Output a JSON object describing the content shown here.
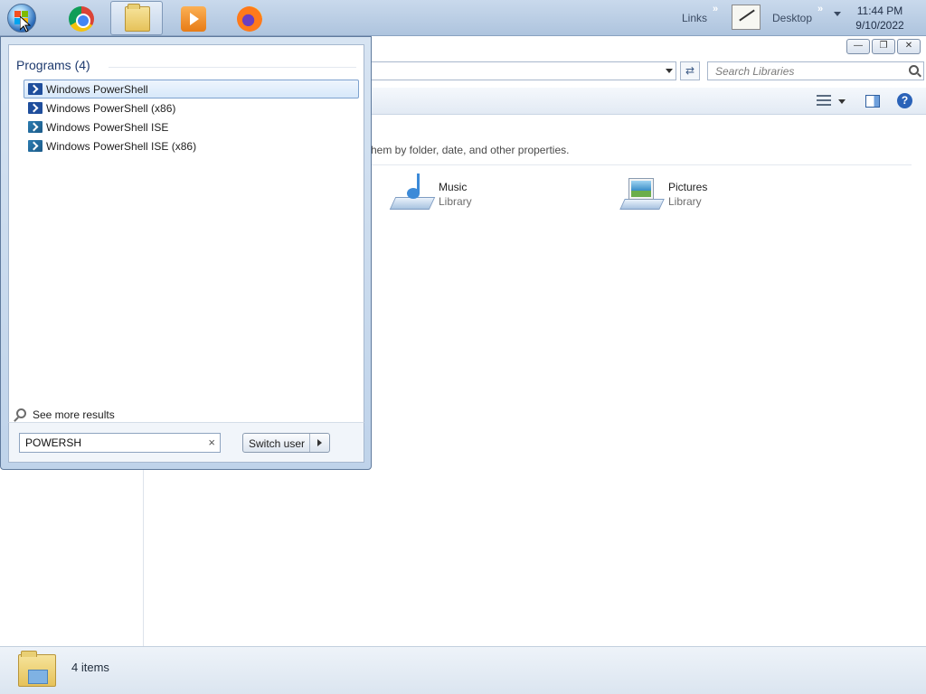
{
  "taskbar": {
    "links_label": "Links",
    "links_chevron": "»",
    "desktop_label": "Desktop",
    "desktop_chevron": "»",
    "time": "11:44 PM",
    "date": "9/10/2022",
    "apps": [
      {
        "icon": "chrome-icon"
      },
      {
        "icon": "folder-icon"
      },
      {
        "icon": "media-player-icon"
      },
      {
        "icon": "firefox-icon"
      }
    ]
  },
  "explorer": {
    "search_placeholder": "Search Libraries",
    "library_description": "hem by folder, date, and other properties.",
    "libraries": [
      {
        "name": "Music",
        "type": "Library",
        "icon": "music-library-icon"
      },
      {
        "name": "Pictures",
        "type": "Library",
        "icon": "pictures-library-icon"
      }
    ],
    "status_text": "4 items"
  },
  "start_menu": {
    "programs_header": "Programs (4)",
    "programs": [
      {
        "label": "Windows PowerShell",
        "selected": true,
        "icon": "powershell-icon"
      },
      {
        "label": "Windows PowerShell (x86)",
        "selected": false,
        "icon": "powershell-icon"
      },
      {
        "label": "Windows PowerShell ISE",
        "selected": false,
        "icon": "powershell-ise-icon"
      },
      {
        "label": "Windows PowerShell ISE (x86)",
        "selected": false,
        "icon": "powershell-ise-icon"
      }
    ],
    "see_more": "See more results",
    "search_value": "POWERSH",
    "clear_glyph": "×",
    "switch_user": "Switch user"
  },
  "colors": {
    "taskbar": "#b7cbe3",
    "selection": "#d7e8fa",
    "accent": "#1e3a6e"
  }
}
